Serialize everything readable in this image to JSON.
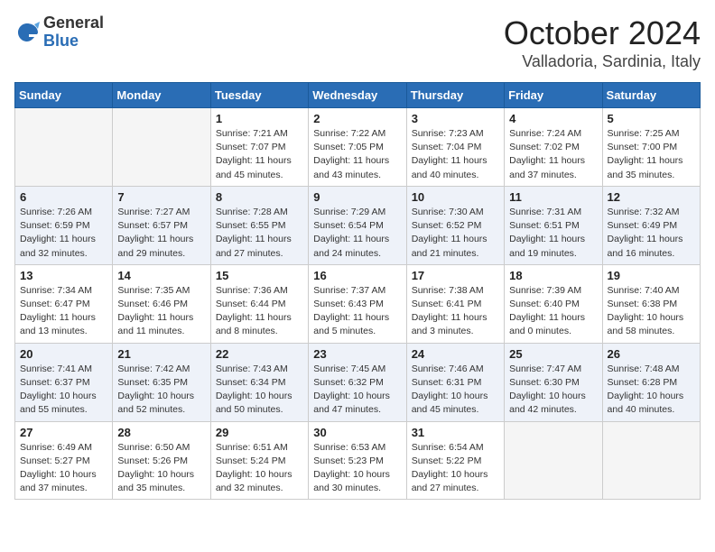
{
  "logo": {
    "general": "General",
    "blue": "Blue"
  },
  "title": "October 2024",
  "location": "Valladoria, Sardinia, Italy",
  "weekdays": [
    "Sunday",
    "Monday",
    "Tuesday",
    "Wednesday",
    "Thursday",
    "Friday",
    "Saturday"
  ],
  "weeks": [
    {
      "alt": false,
      "days": [
        {
          "num": "",
          "info": ""
        },
        {
          "num": "",
          "info": ""
        },
        {
          "num": "1",
          "info": "Sunrise: 7:21 AM\nSunset: 7:07 PM\nDaylight: 11 hours\nand 45 minutes."
        },
        {
          "num": "2",
          "info": "Sunrise: 7:22 AM\nSunset: 7:05 PM\nDaylight: 11 hours\nand 43 minutes."
        },
        {
          "num": "3",
          "info": "Sunrise: 7:23 AM\nSunset: 7:04 PM\nDaylight: 11 hours\nand 40 minutes."
        },
        {
          "num": "4",
          "info": "Sunrise: 7:24 AM\nSunset: 7:02 PM\nDaylight: 11 hours\nand 37 minutes."
        },
        {
          "num": "5",
          "info": "Sunrise: 7:25 AM\nSunset: 7:00 PM\nDaylight: 11 hours\nand 35 minutes."
        }
      ]
    },
    {
      "alt": true,
      "days": [
        {
          "num": "6",
          "info": "Sunrise: 7:26 AM\nSunset: 6:59 PM\nDaylight: 11 hours\nand 32 minutes."
        },
        {
          "num": "7",
          "info": "Sunrise: 7:27 AM\nSunset: 6:57 PM\nDaylight: 11 hours\nand 29 minutes."
        },
        {
          "num": "8",
          "info": "Sunrise: 7:28 AM\nSunset: 6:55 PM\nDaylight: 11 hours\nand 27 minutes."
        },
        {
          "num": "9",
          "info": "Sunrise: 7:29 AM\nSunset: 6:54 PM\nDaylight: 11 hours\nand 24 minutes."
        },
        {
          "num": "10",
          "info": "Sunrise: 7:30 AM\nSunset: 6:52 PM\nDaylight: 11 hours\nand 21 minutes."
        },
        {
          "num": "11",
          "info": "Sunrise: 7:31 AM\nSunset: 6:51 PM\nDaylight: 11 hours\nand 19 minutes."
        },
        {
          "num": "12",
          "info": "Sunrise: 7:32 AM\nSunset: 6:49 PM\nDaylight: 11 hours\nand 16 minutes."
        }
      ]
    },
    {
      "alt": false,
      "days": [
        {
          "num": "13",
          "info": "Sunrise: 7:34 AM\nSunset: 6:47 PM\nDaylight: 11 hours\nand 13 minutes."
        },
        {
          "num": "14",
          "info": "Sunrise: 7:35 AM\nSunset: 6:46 PM\nDaylight: 11 hours\nand 11 minutes."
        },
        {
          "num": "15",
          "info": "Sunrise: 7:36 AM\nSunset: 6:44 PM\nDaylight: 11 hours\nand 8 minutes."
        },
        {
          "num": "16",
          "info": "Sunrise: 7:37 AM\nSunset: 6:43 PM\nDaylight: 11 hours\nand 5 minutes."
        },
        {
          "num": "17",
          "info": "Sunrise: 7:38 AM\nSunset: 6:41 PM\nDaylight: 11 hours\nand 3 minutes."
        },
        {
          "num": "18",
          "info": "Sunrise: 7:39 AM\nSunset: 6:40 PM\nDaylight: 11 hours\nand 0 minutes."
        },
        {
          "num": "19",
          "info": "Sunrise: 7:40 AM\nSunset: 6:38 PM\nDaylight: 10 hours\nand 58 minutes."
        }
      ]
    },
    {
      "alt": true,
      "days": [
        {
          "num": "20",
          "info": "Sunrise: 7:41 AM\nSunset: 6:37 PM\nDaylight: 10 hours\nand 55 minutes."
        },
        {
          "num": "21",
          "info": "Sunrise: 7:42 AM\nSunset: 6:35 PM\nDaylight: 10 hours\nand 52 minutes."
        },
        {
          "num": "22",
          "info": "Sunrise: 7:43 AM\nSunset: 6:34 PM\nDaylight: 10 hours\nand 50 minutes."
        },
        {
          "num": "23",
          "info": "Sunrise: 7:45 AM\nSunset: 6:32 PM\nDaylight: 10 hours\nand 47 minutes."
        },
        {
          "num": "24",
          "info": "Sunrise: 7:46 AM\nSunset: 6:31 PM\nDaylight: 10 hours\nand 45 minutes."
        },
        {
          "num": "25",
          "info": "Sunrise: 7:47 AM\nSunset: 6:30 PM\nDaylight: 10 hours\nand 42 minutes."
        },
        {
          "num": "26",
          "info": "Sunrise: 7:48 AM\nSunset: 6:28 PM\nDaylight: 10 hours\nand 40 minutes."
        }
      ]
    },
    {
      "alt": false,
      "days": [
        {
          "num": "27",
          "info": "Sunrise: 6:49 AM\nSunset: 5:27 PM\nDaylight: 10 hours\nand 37 minutes."
        },
        {
          "num": "28",
          "info": "Sunrise: 6:50 AM\nSunset: 5:26 PM\nDaylight: 10 hours\nand 35 minutes."
        },
        {
          "num": "29",
          "info": "Sunrise: 6:51 AM\nSunset: 5:24 PM\nDaylight: 10 hours\nand 32 minutes."
        },
        {
          "num": "30",
          "info": "Sunrise: 6:53 AM\nSunset: 5:23 PM\nDaylight: 10 hours\nand 30 minutes."
        },
        {
          "num": "31",
          "info": "Sunrise: 6:54 AM\nSunset: 5:22 PM\nDaylight: 10 hours\nand 27 minutes."
        },
        {
          "num": "",
          "info": ""
        },
        {
          "num": "",
          "info": ""
        }
      ]
    }
  ]
}
